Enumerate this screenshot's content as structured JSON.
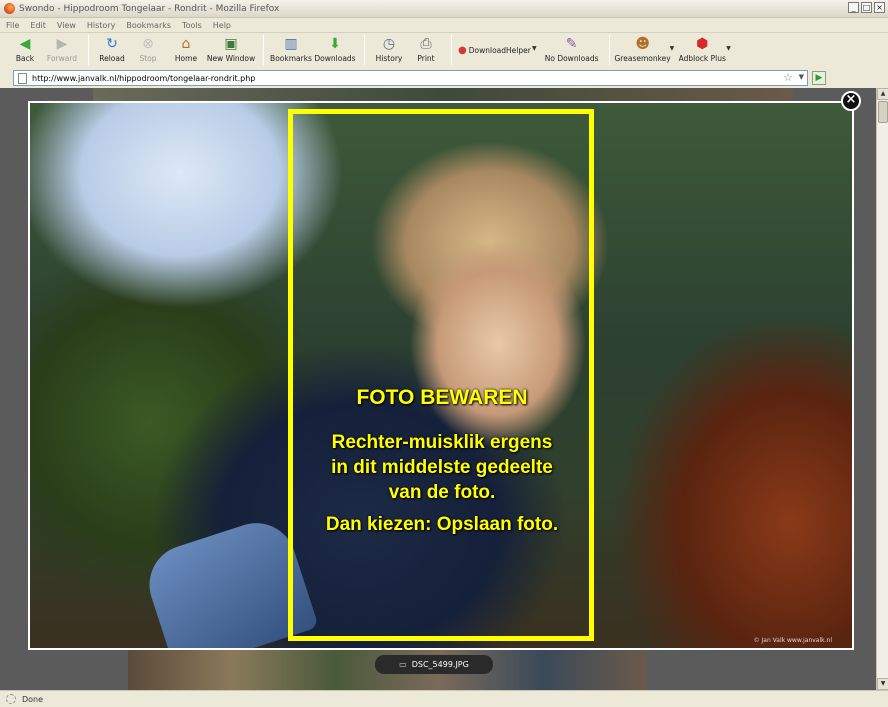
{
  "window": {
    "title": "Swondo - Hippodroom Tongelaar - Rondrit - Mozilla Firefox",
    "buttons": [
      "_",
      "□",
      "×"
    ]
  },
  "menubar": [
    "File",
    "Edit",
    "View",
    "History",
    "Bookmarks",
    "Tools",
    "Help"
  ],
  "toolbar": {
    "back": "Back",
    "forward": "Forward",
    "reload": "Reload",
    "stop": "Stop",
    "home": "Home",
    "new_window": "New Window",
    "bookmarks": "Bookmarks",
    "downloads": "Downloads",
    "history": "History",
    "print": "Print",
    "downloadhelper": "DownloadHelper",
    "no_downloads": "No Downloads",
    "greasemonkey": "Greasemonkey",
    "adblock": "Adblock Plus"
  },
  "url": "http://www.janvalk.nl/hippodroom/tongelaar-rondrit.php",
  "photo": {
    "heading": "FOTO BEWAREN",
    "line1": "Rechter-muisklik ergens",
    "line2": "in dit middelste gedeelte",
    "line3": "van de foto.",
    "line4": "Dan kiezen: Opslaan foto.",
    "copyright": "© Jan Valk    www.janvalk.nl",
    "overlay_color": "#ffff00"
  },
  "filename": "DSC_5499.JPG",
  "status": "Done"
}
